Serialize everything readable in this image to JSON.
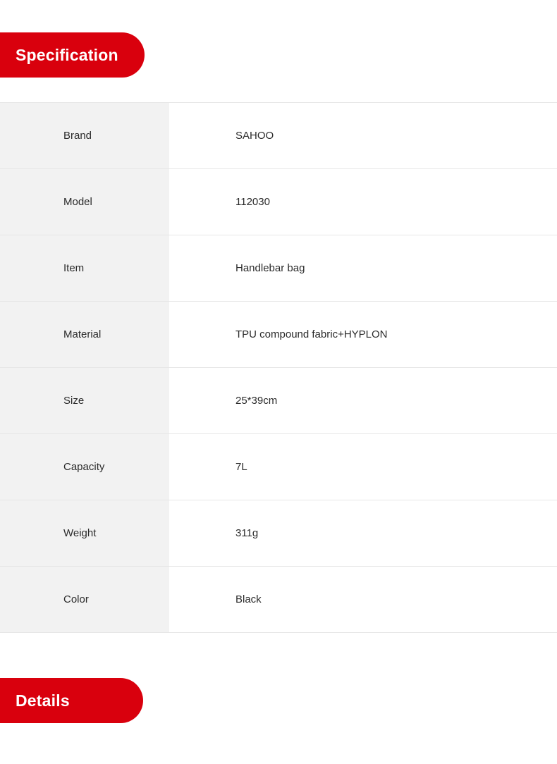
{
  "theme": {
    "accent_red": "#d9000d",
    "label_cell_bg": "#f2f2f2",
    "row_divider": "#e6e6e6",
    "text_color": "#2b2b2b"
  },
  "sections": {
    "specification": {
      "banner_label": "Specification",
      "rows": [
        {
          "label": "Brand",
          "value": "SAHOO"
        },
        {
          "label": "Model",
          "value": "112030"
        },
        {
          "label": "Item",
          "value": "Handlebar bag"
        },
        {
          "label": "Material",
          "value": "TPU compound fabric+HYPLON"
        },
        {
          "label": "Size",
          "value": "25*39cm"
        },
        {
          "label": "Capacity",
          "value": "7L"
        },
        {
          "label": "Weight",
          "value": "311g"
        },
        {
          "label": "Color",
          "value": "Black"
        }
      ]
    },
    "details": {
      "banner_label": "Details"
    }
  }
}
